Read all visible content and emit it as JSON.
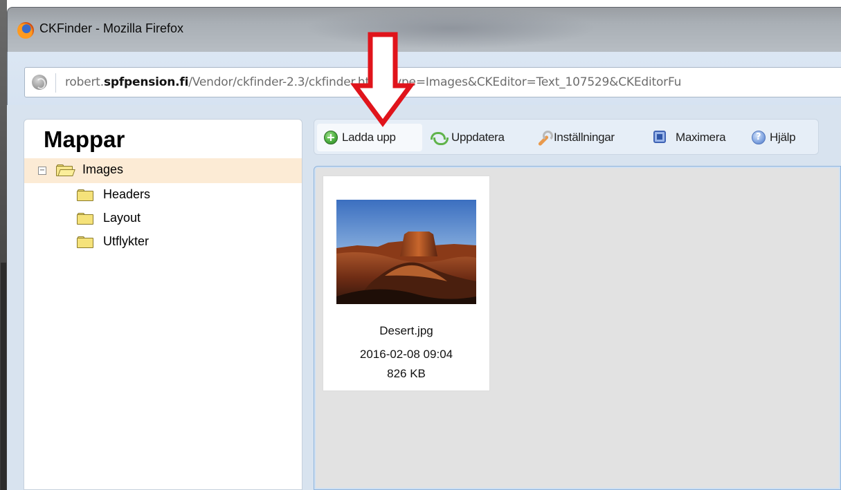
{
  "window": {
    "title": "CKFinder - Mozilla Firefox"
  },
  "address_bar": {
    "url_prefix": "robert.",
    "url_domain": "spfpension.fi",
    "url_rest": "/Vendor/ckfinder-2.3/ckfinder.html?type=Images&CKEditor=Text_107529&CKEditorFu"
  },
  "folders_panel": {
    "title": "Mappar",
    "tree": [
      {
        "label": "Images",
        "expanded": true,
        "selected": true,
        "level": 0
      },
      {
        "label": "Headers",
        "level": 1
      },
      {
        "label": "Layout",
        "level": 1
      },
      {
        "label": "Utflykter",
        "level": 1
      }
    ]
  },
  "toolbar": {
    "upload_label": "Ladda upp",
    "refresh_label": "Uppdatera",
    "settings_label": "Inställningar",
    "maximize_label": "Maximera",
    "help_label": "Hjälp"
  },
  "files": [
    {
      "name": "Desert.jpg",
      "date": "2016-02-08 09:04",
      "size": "826 KB"
    }
  ],
  "colors": {
    "annotation_arrow": "#e0141b",
    "selected_row": "#fcebd5",
    "files_area": "#e2e2e2"
  },
  "icons": {
    "upload": "add-circle-icon",
    "refresh": "refresh-arrows-icon",
    "settings": "wrench-icon",
    "maximize": "maximize-icon",
    "help": "help-icon"
  }
}
